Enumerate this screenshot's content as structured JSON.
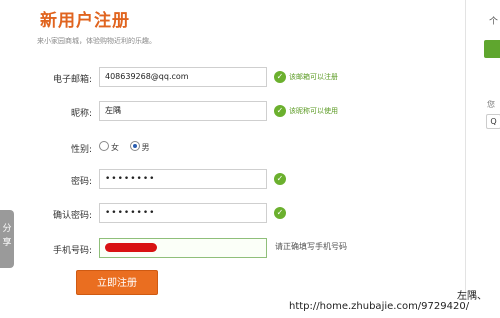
{
  "page": {
    "title": "新用户注册",
    "subtitle": "来小家园商城，体验购物近利的乐趣。"
  },
  "form": {
    "email": {
      "label": "电子邮箱:",
      "value": "408639268@qq.com",
      "status": "该邮箱可以注册"
    },
    "nickname": {
      "label": "昵称:",
      "value": "左隅",
      "status": "该昵称可以使用"
    },
    "gender": {
      "label": "性别:",
      "options": [
        "女",
        "男"
      ],
      "selected": "男"
    },
    "password": {
      "label": "密码:",
      "value": "••••••••"
    },
    "confirm_password": {
      "label": "确认密码:",
      "value": "••••••••"
    },
    "phone": {
      "label": "手机号码:",
      "hint": "请正确填写手机号码"
    },
    "submit_label": "立即注册"
  },
  "side": {
    "share_label": "分享",
    "top_tag": "个",
    "you_label": "您",
    "qq_label": "Q"
  },
  "watermark": {
    "name": "左隅、",
    "url": "http://home.zhubajie.com/9729420/"
  },
  "colors": {
    "accent": "#e0641f",
    "success": "#6bb02e",
    "button": "#ea6e20"
  },
  "icons": {
    "check": "check-circle-icon",
    "radio": "radio-icon"
  }
}
